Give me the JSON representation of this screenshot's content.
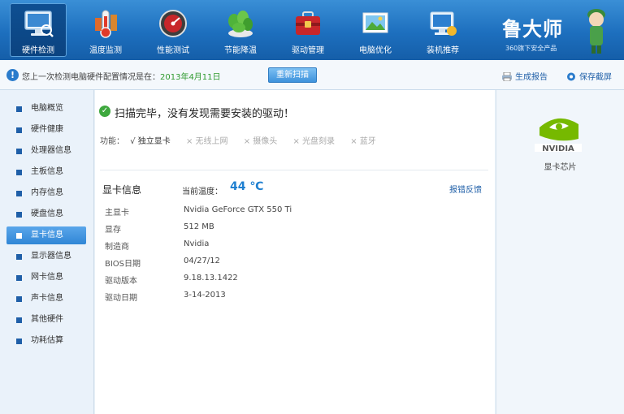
{
  "toolbar": {
    "items": [
      {
        "label": "硬件检测",
        "icon": "monitor-icon"
      },
      {
        "label": "温度监测",
        "icon": "thermometer-icon"
      },
      {
        "label": "性能测试",
        "icon": "speedometer-icon"
      },
      {
        "label": "节能降温",
        "icon": "leaf-icon"
      },
      {
        "label": "驱动管理",
        "icon": "toolbox-icon"
      },
      {
        "label": "电脑优化",
        "icon": "picture-icon"
      },
      {
        "label": "装机推荐",
        "icon": "computer-icon"
      }
    ],
    "active_index": 0
  },
  "brand": {
    "name": "鲁大师",
    "slogan": "360旗下安全产品"
  },
  "status": {
    "text_prefix": "您上一次检测电脑硬件配置情况是在：",
    "date": "2013年4月11日",
    "recheck_label": "重新扫描",
    "generate_report": "生成报告",
    "save_screenshot": "保存截屏"
  },
  "sidebar": {
    "items": [
      "电脑概览",
      "硬件健康",
      "处理器信息",
      "主板信息",
      "内存信息",
      "硬盘信息",
      "显卡信息",
      "显示器信息",
      "网卡信息",
      "声卡信息",
      "其他硬件",
      "功耗估算"
    ],
    "active_index": 6
  },
  "main": {
    "scan_message": "扫描完毕，没有发现需要安装的驱动！",
    "functions_label": "功能：",
    "functions": [
      {
        "label": "√ 独立显卡",
        "enabled": true
      },
      {
        "label": "× 无线上网",
        "enabled": false
      },
      {
        "label": "× 摄像头",
        "enabled": false
      },
      {
        "label": "× 光盘刻录",
        "enabled": false
      },
      {
        "label": "× 蓝牙",
        "enabled": false
      }
    ],
    "section_title": "显卡信息",
    "temp_label": "当前温度：",
    "temp_value": "44 ℃",
    "feedback_link": "报错反馈",
    "details": [
      {
        "key": "主显卡",
        "value": "Nvidia GeForce GTX 550 Ti"
      },
      {
        "key": "显存",
        "value": "512 MB"
      },
      {
        "key": "制造商",
        "value": "Nvidia"
      },
      {
        "key": "BIOS日期",
        "value": "04/27/12"
      },
      {
        "key": "驱动版本",
        "value": "9.18.13.1422"
      },
      {
        "key": "驱动日期",
        "value": "3-14-2013"
      }
    ]
  },
  "right_panel": {
    "logo": "nvidia-logo",
    "label": "显卡芯片"
  },
  "colors": {
    "toolbar_blue": "#1d6fbe",
    "active_item": "#2f86d6",
    "temperature": "#1e7fd0",
    "date_green": "#2f9a2f",
    "nvidia_green": "#76b900"
  }
}
